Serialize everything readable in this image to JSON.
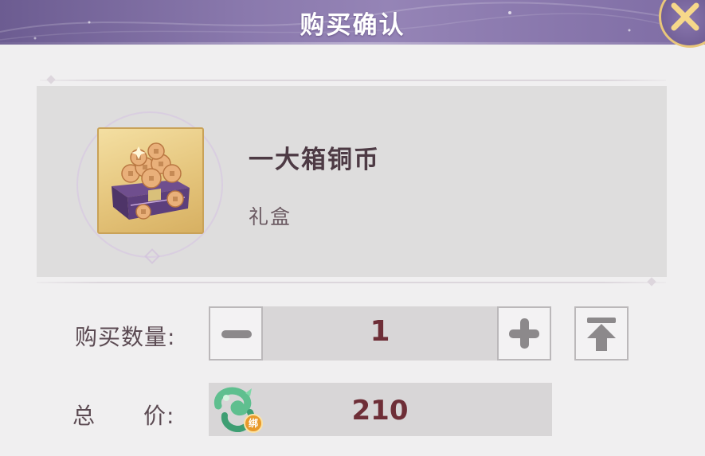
{
  "dialog": {
    "title": "购买确认",
    "close_icon": "close-x-icon"
  },
  "item": {
    "name": "一大箱铜币",
    "type": "礼盒",
    "icon": "copper-coin-chest-icon"
  },
  "quantity": {
    "label": "购买数量:",
    "value": "1",
    "decrease_icon": "minus-icon",
    "increase_icon": "plus-icon",
    "max_icon": "max-arrow-up-icon"
  },
  "total": {
    "label_left": "总",
    "label_right": "价:",
    "value": "210",
    "currency_icon": "bound-jade-currency-icon",
    "bind_badge": "绑"
  },
  "colors": {
    "header": "#7e6ca4",
    "accent_gold": "#e9c77a",
    "value_text": "#6e2e37"
  }
}
